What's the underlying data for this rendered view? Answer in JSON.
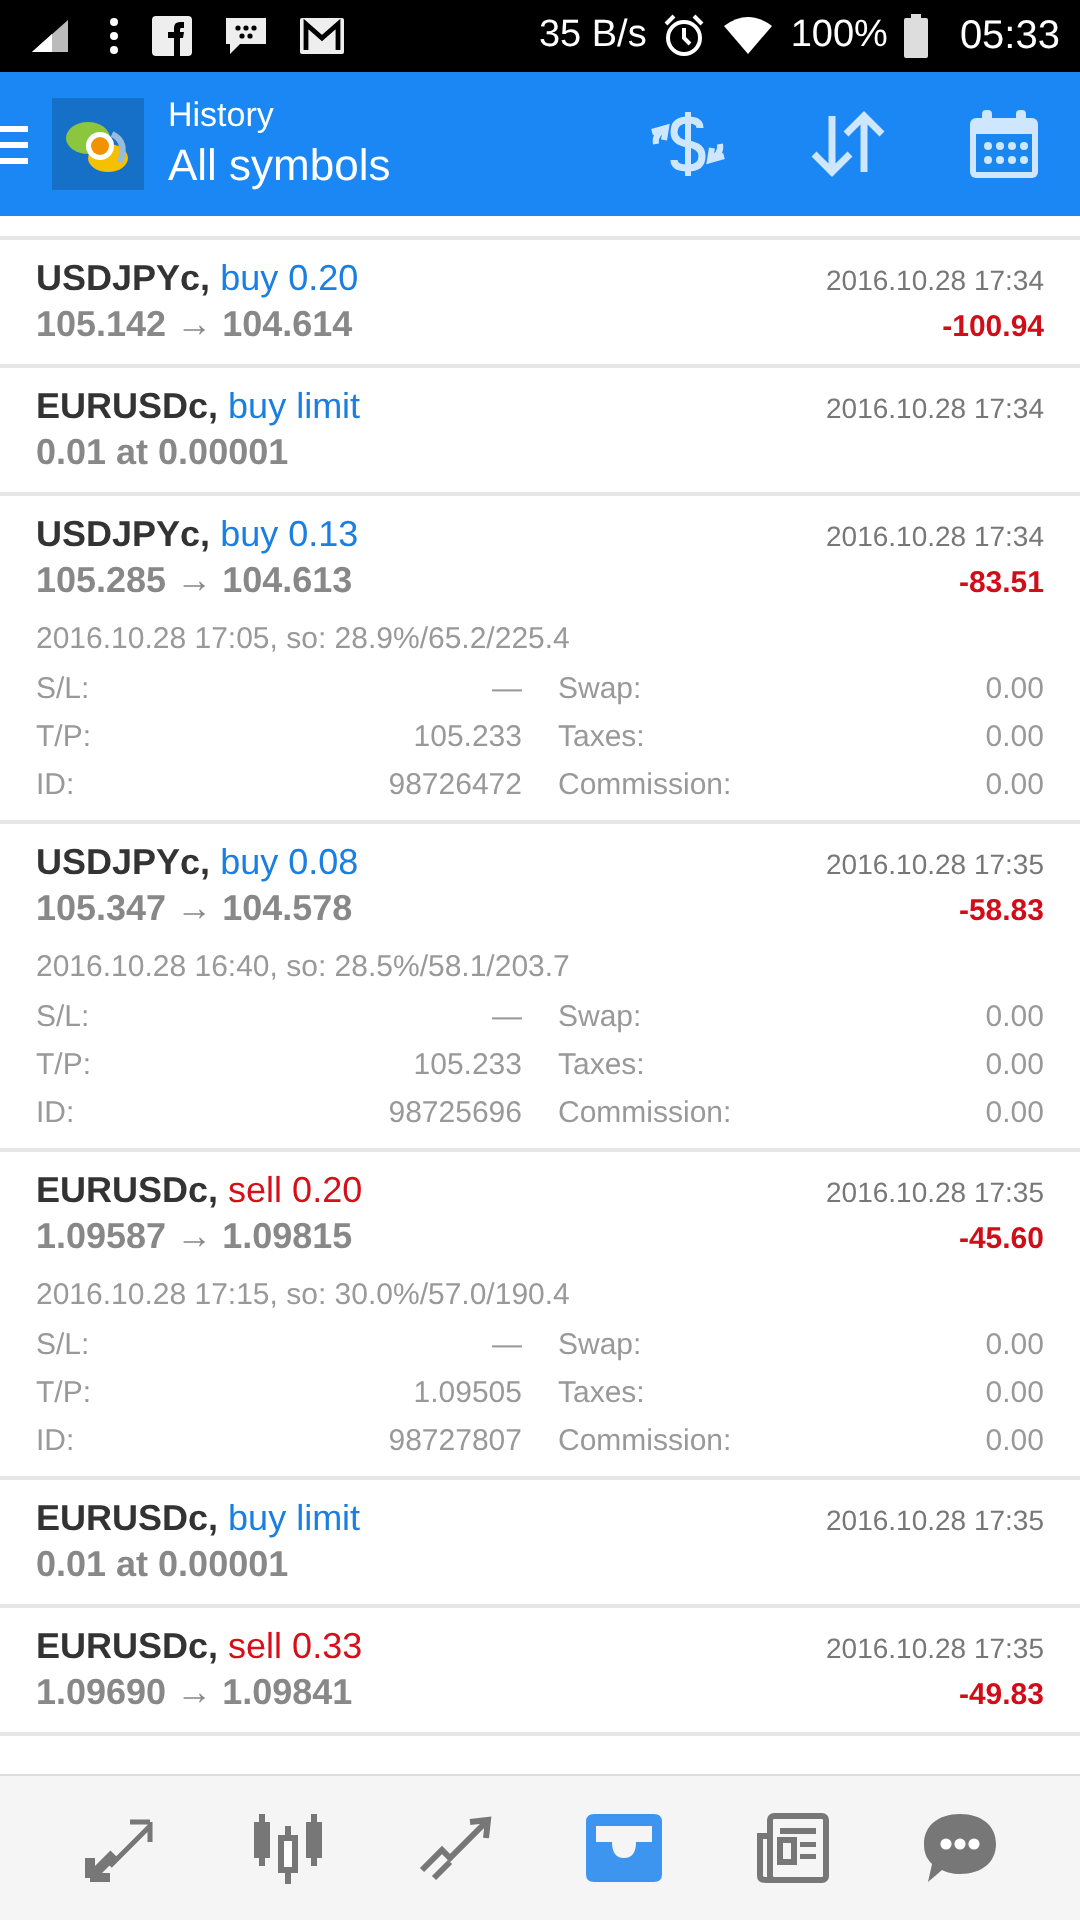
{
  "status_bar": {
    "speed": "35 B/s",
    "battery": "100%",
    "time": "05:33"
  },
  "header": {
    "subtitle": "History",
    "title": "All symbols"
  },
  "trades": [
    {
      "kind": "closed",
      "symbol": "USDJPYc,",
      "order": "buy 0.20",
      "color": "#1a7fe0",
      "time": "2016.10.28 17:34",
      "prices": "105.142 → 104.614",
      "profit": "-100.94",
      "expanded": false
    },
    {
      "kind": "pending",
      "symbol": "EURUSDc,",
      "order": "buy limit",
      "color": "#1a7fe0",
      "time": "2016.10.28 17:34",
      "prices": "0.01 at 0.00001",
      "expanded": false
    },
    {
      "kind": "closed",
      "symbol": "USDJPYc,",
      "order": "buy 0.13",
      "color": "#1a7fe0",
      "time": "2016.10.28 17:34",
      "prices": "105.285 → 104.613",
      "profit": "-83.51",
      "expanded": true,
      "opened": "2016.10.28 17:05, so: 28.9%/65.2/225.4",
      "details": [
        [
          "S/L:",
          "—",
          "Swap:",
          "0.00"
        ],
        [
          "T/P:",
          "105.233",
          "Taxes:",
          "0.00"
        ],
        [
          "ID:",
          "98726472",
          "Commission:",
          "0.00"
        ]
      ]
    },
    {
      "kind": "closed",
      "symbol": "USDJPYc,",
      "order": "buy 0.08",
      "color": "#1a7fe0",
      "time": "2016.10.28 17:35",
      "prices": "105.347 → 104.578",
      "profit": "-58.83",
      "expanded": true,
      "opened": "2016.10.28 16:40, so: 28.5%/58.1/203.7",
      "details": [
        [
          "S/L:",
          "—",
          "Swap:",
          "0.00"
        ],
        [
          "T/P:",
          "105.233",
          "Taxes:",
          "0.00"
        ],
        [
          "ID:",
          "98725696",
          "Commission:",
          "0.00"
        ]
      ]
    },
    {
      "kind": "closed",
      "symbol": "EURUSDc,",
      "order": "sell 0.20",
      "color": "#d6101a",
      "time": "2016.10.28 17:35",
      "prices": "1.09587 → 1.09815",
      "profit": "-45.60",
      "expanded": true,
      "opened": "2016.10.28 17:15, so: 30.0%/57.0/190.4",
      "details": [
        [
          "S/L:",
          "—",
          "Swap:",
          "0.00"
        ],
        [
          "T/P:",
          "1.09505",
          "Taxes:",
          "0.00"
        ],
        [
          "ID:",
          "98727807",
          "Commission:",
          "0.00"
        ]
      ]
    },
    {
      "kind": "pending",
      "symbol": "EURUSDc,",
      "order": "buy limit",
      "color": "#1a7fe0",
      "time": "2016.10.28 17:35",
      "prices": "0.01 at 0.00001",
      "expanded": false
    },
    {
      "kind": "closed",
      "symbol": "EURUSDc,",
      "order": "sell 0.33",
      "color": "#d6101a",
      "time": "2016.10.28 17:35",
      "prices": "1.09690 → 1.09841",
      "profit": "-49.83",
      "expanded": false
    }
  ],
  "nav": [
    {
      "kind": "trade",
      "selected": false
    },
    {
      "kind": "chart",
      "selected": false
    },
    {
      "kind": "quotes",
      "selected": false
    },
    {
      "kind": "history",
      "selected": true
    },
    {
      "kind": "news",
      "selected": false
    },
    {
      "kind": "chat",
      "selected": false
    }
  ]
}
